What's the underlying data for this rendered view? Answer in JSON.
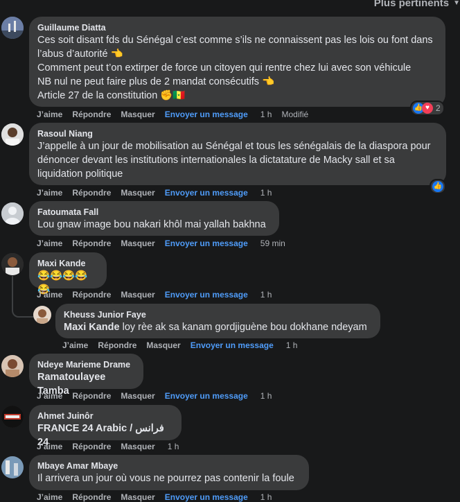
{
  "sort_label": "Plus pertinents",
  "actions": {
    "like": "J’aime",
    "reply": "Répondre",
    "hide": "Masquer",
    "send_message": "Envoyer un message",
    "edited": "Modifié"
  },
  "comments": [
    {
      "author": "Guillaume Diatta",
      "lines": [
        "Ces soit disant fds du Sénégal c’est comme s’ils ne connaissent pas les lois ou font dans",
        "l’abus d’autorité 👈",
        "Comment peut t’on extirper de force un citoyen qui rentre chez lui avec son véhicule",
        "NB nul ne peut faire plus de 2 mandat consécutifs 👈",
        "Article 27 de la constitution ✊🇸🇳"
      ],
      "time": "1 h",
      "reaction_count": "2"
    },
    {
      "author": "Rasoul Niang",
      "lines": [
        "J’appelle à un jour de mobilisation au Sénégal et tous les sénégalais de la diaspora pour",
        "dénoncer devant les institutions internationales la dictatature de Macky sall et sa",
        "liquidation politique"
      ],
      "time": "1 h"
    },
    {
      "author": "Fatoumata Fall",
      "lines": [
        "Lou gnaw image bou nakari khôl mai yallah bakhna"
      ],
      "time": "59 min"
    },
    {
      "author": "Maxi Kande",
      "lines": [
        "😂😂😂😂😂"
      ],
      "time": "1 h"
    },
    {
      "author": "Kheuss Junior Faye",
      "mention": "Maxi Kande",
      "lines": [
        " loy rèe ak sa kanam gordjiguène bou dokhane ndeyam"
      ],
      "time": "1 h"
    },
    {
      "author": "Ndeye Marieme Drame",
      "lines": [
        "Ramatoulayee Tamba"
      ],
      "time": "1 h"
    },
    {
      "author": "Ahmet Juinôr",
      "lines": [
        "FRANCE 24 Arabic / فرانس 24"
      ],
      "time": "1 h"
    },
    {
      "author": "Mbaye Amar Mbaye",
      "lines": [
        "Il arrivera un jour où vous ne pourrez pas contenir la foule"
      ],
      "time": "1 h"
    }
  ]
}
